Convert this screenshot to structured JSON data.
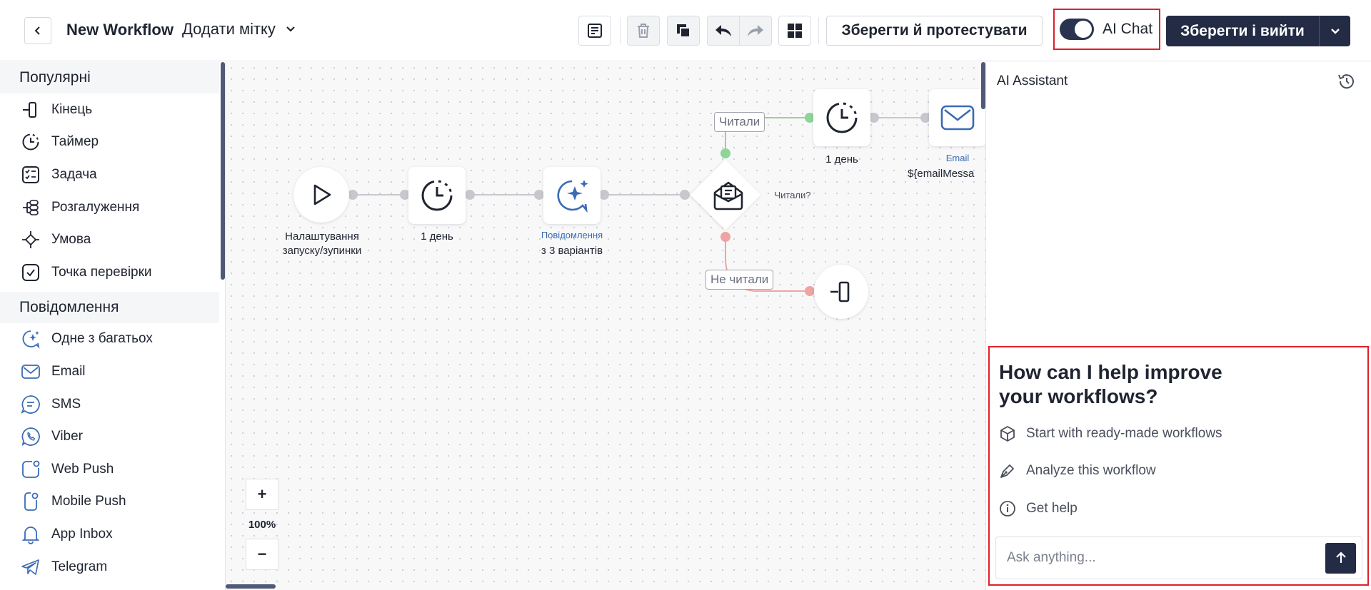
{
  "header": {
    "title": "New Workflow",
    "tag_dropdown": "Додати мітку",
    "save_test_label": "Зберегти й протестувати",
    "ai_chat_label": "AI Chat",
    "ai_chat_enabled": true,
    "save_exit_label": "Зберегти і вийти"
  },
  "sidebar": {
    "sections": [
      {
        "title": "Популярні",
        "items": [
          {
            "label": "Кінець",
            "icon": "end-icon"
          },
          {
            "label": "Таймер",
            "icon": "timer-icon"
          },
          {
            "label": "Задача",
            "icon": "task-icon"
          },
          {
            "label": "Розгалуження",
            "icon": "branch-icon"
          },
          {
            "label": "Умова",
            "icon": "condition-icon"
          },
          {
            "label": "Точка перевірки",
            "icon": "checkpoint-icon"
          }
        ]
      },
      {
        "title": "Повідомлення",
        "items": [
          {
            "label": "Одне з багатьох",
            "icon": "sparkle-chat-icon"
          },
          {
            "label": "Email",
            "icon": "email-icon"
          },
          {
            "label": "SMS",
            "icon": "sms-icon"
          },
          {
            "label": "Viber",
            "icon": "viber-icon"
          },
          {
            "label": "Web Push",
            "icon": "web-push-icon"
          },
          {
            "label": "Mobile Push",
            "icon": "mobile-push-icon"
          },
          {
            "label": "App Inbox",
            "icon": "bell-icon"
          },
          {
            "label": "Telegram",
            "icon": "telegram-icon"
          }
        ]
      }
    ]
  },
  "canvas": {
    "nodes": {
      "start_label": "Налаштування запуску/зупинки",
      "timer1_label": "1 день",
      "message_sub": "Повідомлення",
      "message_label": "з 3 варіантів",
      "condition_label": "Читали?",
      "timer2_label": "1 день",
      "email_sub": "Email",
      "email_label": "${emailMessa"
    },
    "branches": {
      "yes": "Читали",
      "no": "Не читали"
    },
    "zoom": "100%"
  },
  "ai_panel": {
    "title": "AI Assistant",
    "headline": "How can I help improve your workflows?",
    "suggestions": [
      {
        "label": "Start with ready-made workflows",
        "icon": "cube-icon"
      },
      {
        "label": "Analyze this workflow",
        "icon": "pen-icon"
      },
      {
        "label": "Get help",
        "icon": "info-icon"
      }
    ],
    "input_placeholder": "Ask anything..."
  }
}
